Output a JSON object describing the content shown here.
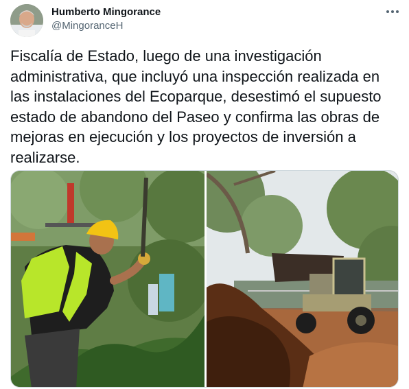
{
  "author": {
    "name": "Humberto Mingorance",
    "handle": "@MingoranceH"
  },
  "tweet": {
    "text": "Fiscalía de Estado, luego de una investigación administrativa, que incluyó una inspección realizada en las instalaciones del Ecoparque, desestimó el supuesto estado de abandono del Paseo y confirma las obras de mejoras en ejecución y los proyectos de inversión a realizarse."
  },
  "icons": {
    "more": "more-dots-icon"
  },
  "colors": {
    "text": "#0f1419",
    "secondary": "#536471",
    "border": "#cfd9de",
    "vest": "#b8e62a",
    "helmet": "#f2c314",
    "soil": "#6b3a1f"
  }
}
